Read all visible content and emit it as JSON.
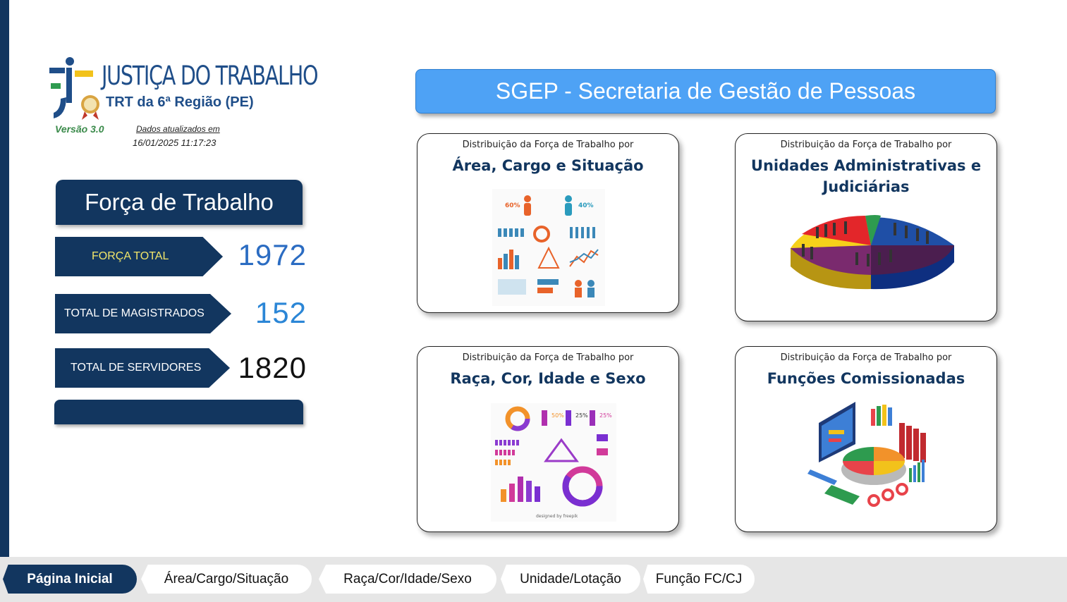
{
  "logo": {
    "title": "JUSTIÇA DO TRABALHO",
    "subtitle": "TRT da 6ª Região (PE)",
    "version": "Versão 3.0",
    "updated_label": "Dados atualizados em",
    "updated_date": "16/01/2025 11:17:23"
  },
  "forca": {
    "header": "Força de Trabalho",
    "kpis": [
      {
        "label": "FORÇA TOTAL",
        "value": "1972"
      },
      {
        "label": "TOTAL DE MAGISTRADOS",
        "value": "152"
      },
      {
        "label": "TOTAL DE SERVIDORES",
        "value": "1820"
      }
    ]
  },
  "banner": "SGEP - Secretaria de Gestão de Pessoas",
  "cards": [
    {
      "subtitle": "Distribuição da Força de Trabalho por",
      "title": "Área, Cargo e Situação",
      "image": "demographics-infographic-icon"
    },
    {
      "subtitle": "Distribuição da Força de Trabalho por",
      "title": "Unidades Administrativas e Judiciárias",
      "image": "population-pie-chart-icon"
    },
    {
      "subtitle": "Distribuição da Força de Trabalho por",
      "title": "Raça, Cor, Idade e Sexo",
      "image": "gender-age-infographic-icon"
    },
    {
      "subtitle": "Distribuição da Força de Trabalho por",
      "title": "Funções Comissionadas",
      "image": "finance-dashboard-illustration-icon"
    }
  ],
  "nav": {
    "tabs": [
      "Página Inicial",
      "Área/Cargo/Situação",
      "Raça/Cor/Idade/Sexo",
      "Unidade/Lotação",
      "Função FC/CJ"
    ],
    "active": "Página Inicial"
  },
  "colors": {
    "navy": "#12365f",
    "banner_blue": "#4ea2f5",
    "kpi_total_color": "#2b6cc2",
    "kpi_magistrados_color": "#2b86d6",
    "force_label_yellow": "#f2e66a",
    "version_green": "#3a8a4a"
  }
}
